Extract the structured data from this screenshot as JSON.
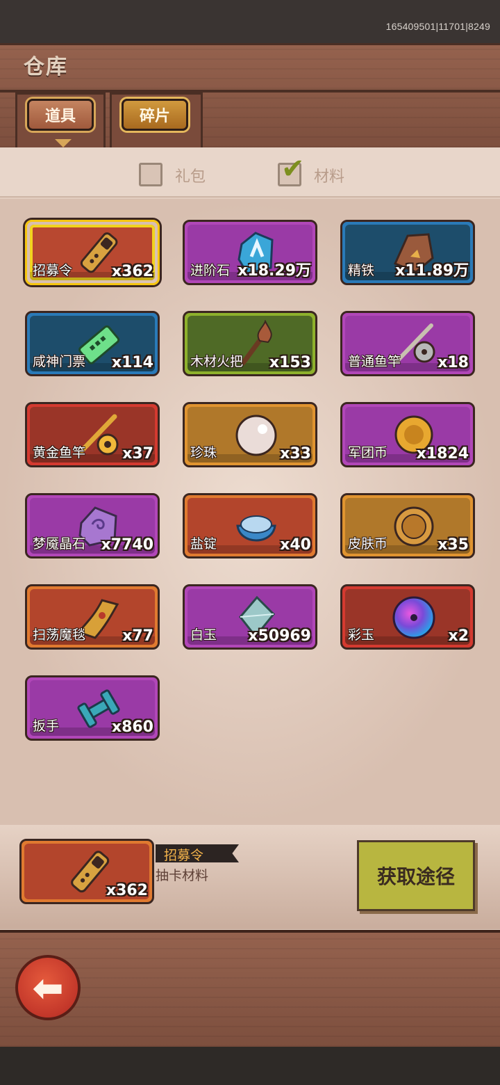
{
  "status": {
    "build_id": "165409501|11701|8249"
  },
  "header": {
    "title": "仓库",
    "tabs": [
      {
        "label": "道具",
        "active": true
      },
      {
        "label": "碎片",
        "active": false
      }
    ]
  },
  "filters": [
    {
      "label": "礼包",
      "checked": false
    },
    {
      "label": "材料",
      "checked": true
    }
  ],
  "items": [
    {
      "name": "招募令",
      "qty": "x362",
      "rarity": "gold",
      "icon": "coffin-token-icon"
    },
    {
      "name": "进阶石",
      "qty": "x18.29万",
      "rarity": "purple",
      "icon": "rune-stone-icon"
    },
    {
      "name": "精铁",
      "qty": "x11.89万",
      "rarity": "blue",
      "icon": "iron-ore-icon"
    },
    {
      "name": "咸神门票",
      "qty": "x114",
      "rarity": "blue",
      "icon": "ticket-icon"
    },
    {
      "name": "木材火把",
      "qty": "x153",
      "rarity": "green",
      "icon": "torch-icon"
    },
    {
      "name": "普通鱼竿",
      "qty": "x18",
      "rarity": "purple",
      "icon": "fishing-rod-icon"
    },
    {
      "name": "黄金鱼竿",
      "qty": "x37",
      "rarity": "red",
      "icon": "golden-fishing-rod-icon"
    },
    {
      "name": "珍珠",
      "qty": "x33",
      "rarity": "orange",
      "icon": "pearl-icon"
    },
    {
      "name": "军团币",
      "qty": "x1824",
      "rarity": "purple",
      "icon": "legion-coin-icon"
    },
    {
      "name": "梦魇晶石",
      "qty": "x7740",
      "rarity": "purple",
      "icon": "nightmare-crystal-icon"
    },
    {
      "name": "盐锭",
      "qty": "x40",
      "rarity": "orange2",
      "icon": "salt-ingot-icon"
    },
    {
      "name": "皮肤币",
      "qty": "x35",
      "rarity": "orange",
      "icon": "skin-coin-icon"
    },
    {
      "name": "扫荡魔毯",
      "qty": "x77",
      "rarity": "orange2",
      "icon": "magic-carpet-icon"
    },
    {
      "name": "白玉",
      "qty": "x50969",
      "rarity": "purple",
      "icon": "white-jade-icon"
    },
    {
      "name": "彩玉",
      "qty": "x2",
      "rarity": "red",
      "icon": "rainbow-jade-icon"
    },
    {
      "name": "扳手",
      "qty": "x860",
      "rarity": "purple",
      "icon": "wrench-icon"
    }
  ],
  "selected": {
    "name": "招募令",
    "qty": "x362",
    "description": "抽卡材料",
    "icon": "coffin-token-icon"
  },
  "source_button": {
    "label": "获取途径"
  },
  "back_button": {
    "icon": "back-arrow-icon"
  },
  "colors": {
    "gold": "#f6c610",
    "purple": "#b147b8",
    "blue": "#2a7ab8",
    "green": "#8eb12c",
    "red": "#d43a30",
    "orange": "#e09430",
    "source_button": "#b8b640"
  }
}
